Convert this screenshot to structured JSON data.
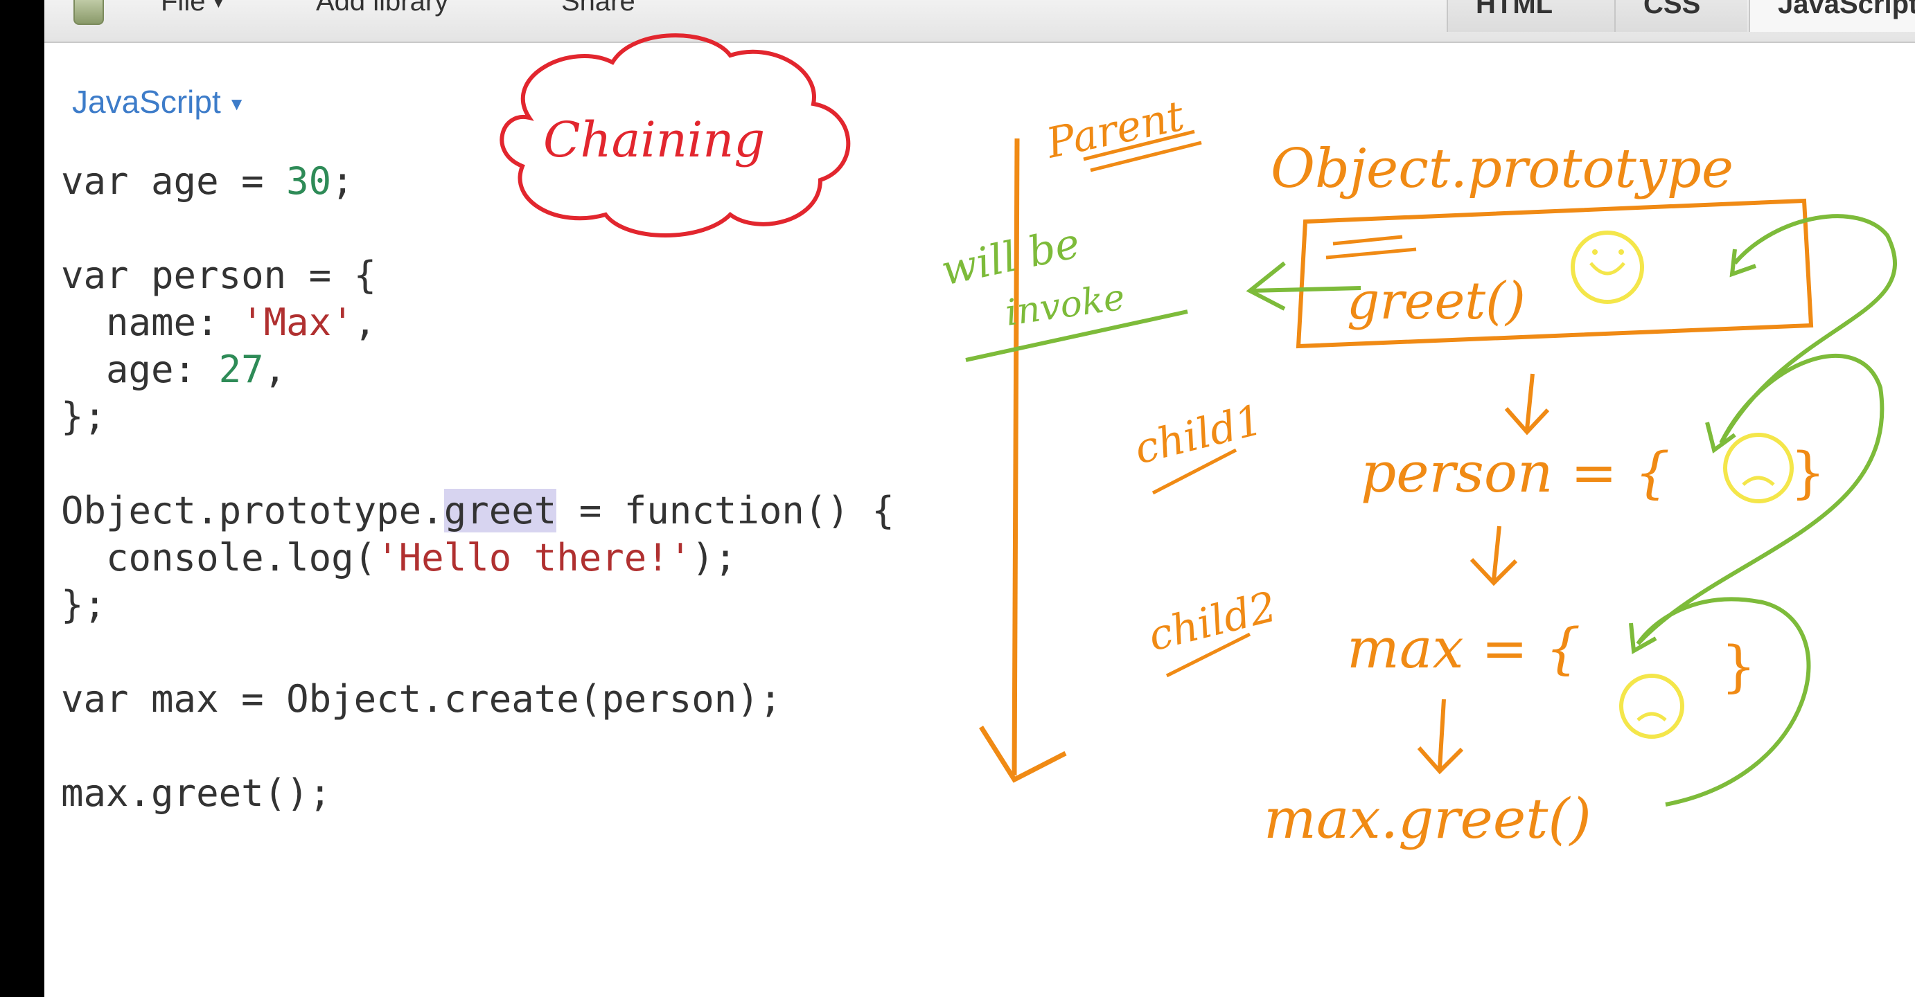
{
  "toolbar": {
    "file_label": "File",
    "add_library_label": "Add library",
    "share_label": "Share",
    "tabs": [
      "HTML",
      "CSS",
      "JavaScript"
    ]
  },
  "editor": {
    "language_label": "JavaScript",
    "code": {
      "l1": [
        "var age = ",
        "30",
        ";"
      ],
      "l2": "var person = {",
      "l3": [
        "  name: ",
        "'Max'",
        ","
      ],
      "l4": [
        "  age: ",
        "27",
        ","
      ],
      "l5": "};",
      "l6": [
        "Object.prototype.",
        "greet",
        " = function() {"
      ],
      "l7": [
        "  console.log(",
        "'Hello there!'",
        ");"
      ],
      "l8": "};",
      "l9": "var max = Object.create(person);",
      "l10": "max.greet();"
    }
  },
  "annotations": {
    "cloud_text": "Chaining",
    "parent": "Parent",
    "object_prototype": "Object.prototype",
    "greet_fn": "greet()",
    "will_be_invoke_1": "will be",
    "will_be_invoke_2": "invoke",
    "child1": "child1",
    "person_eq": "person = {",
    "child2": "child2",
    "max_eq": "max = {",
    "max_greet": "max.greet()",
    "colors": {
      "red": "#e2262e",
      "orange": "#f08a14",
      "green": "#7dbb3a",
      "yellow": "#f4e64a"
    }
  }
}
